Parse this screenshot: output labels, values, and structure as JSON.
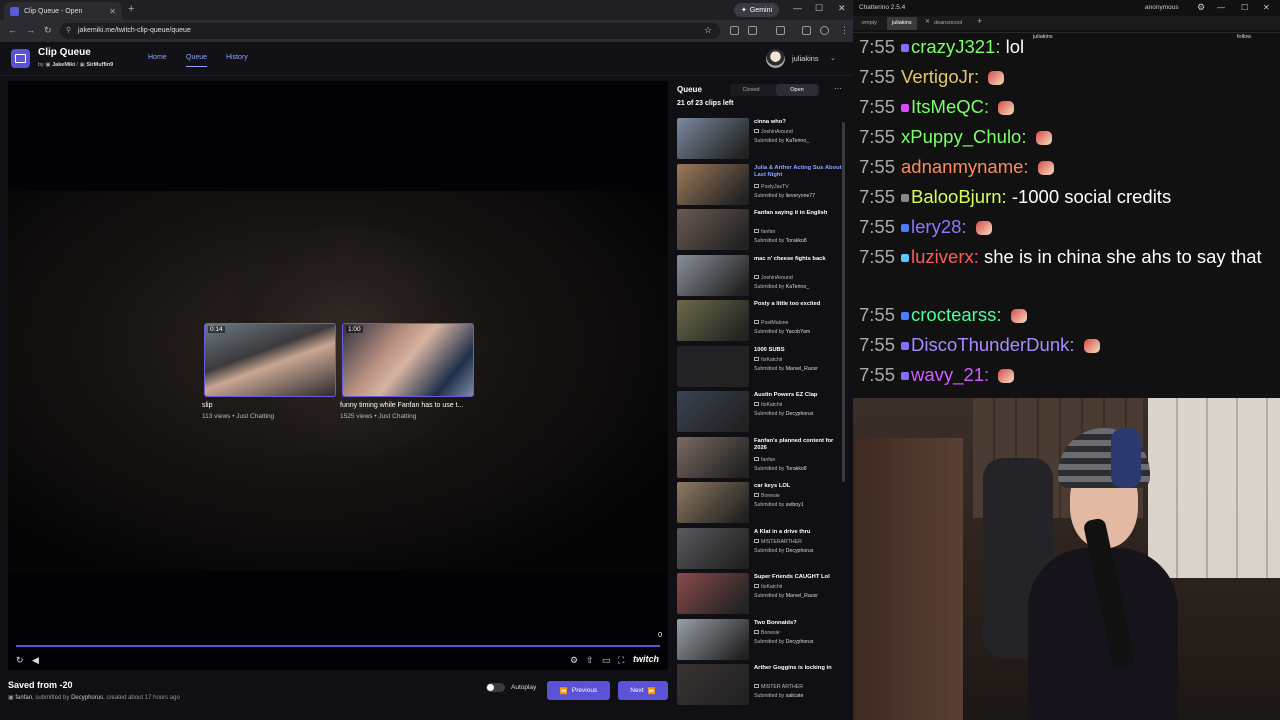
{
  "browser": {
    "tab_title": "Clip Queue - Open",
    "url": "jakemiki.me/twitch-clip-queue/queue",
    "gemini_label": "Gemini"
  },
  "app": {
    "title": "Clip Queue",
    "by_label": "by",
    "author1": "JakeMiki",
    "sep": "/",
    "author2": "SirMuffin9",
    "nav": [
      "Home",
      "Queue",
      "History"
    ],
    "user": "juliakins"
  },
  "player": {
    "clips": [
      {
        "duration": "0:14",
        "title": "slip",
        "meta": "113 views • Just Chatting"
      },
      {
        "duration": "1:00",
        "title": "funny timing while Fanfan has to use t...",
        "meta": "1525 views • Just Chatting"
      }
    ],
    "counter": "0",
    "twitch_logo": "twitch"
  },
  "current": {
    "title": "Saved from -20",
    "channel": "fanfan",
    "submitted_label": ", submitted by",
    "submitter": "Decyphorus",
    "created": ", created about 17 hours ago"
  },
  "controls": {
    "autoplay_label": "Autoplay",
    "previous_label": "Previous",
    "next_label": "Next"
  },
  "queue": {
    "heading": "Queue",
    "tab_closed": "Closed",
    "tab_open": "Open",
    "count_text": "21 of 23 clips left",
    "submitted_prefix": "Submitted by",
    "items": [
      {
        "title": "cinna who?",
        "channel": "JoshinAround",
        "submitter": "KaTerino_",
        "color": "#7a8aa0"
      },
      {
        "title": "Julia & Arther Acting Sus About Last Night",
        "channel": "PostyJasTV",
        "submitter": "lieveryone77",
        "color": "#9c7a5a"
      },
      {
        "title": "Fanfan saying it in English",
        "channel": "fanfan",
        "submitter": "Torakko8",
        "color": "#6a5a52"
      },
      {
        "title": "mac n' cheese fights back",
        "channel": "JoshinAround",
        "submitter": "KaTerino_",
        "color": "#8a8f9a"
      },
      {
        "title": "Posty a little too excited",
        "channel": "PostMalone",
        "submitter": "YacobYam",
        "color": "#6c6a4a"
      },
      {
        "title": "1000 SUBS",
        "channel": "ItsKatchii",
        "submitter": "Marvel_Racer",
        "color": "#222226"
      },
      {
        "title": "Austin Powers EZ Clap",
        "channel": "ItsKatchii",
        "submitter": "Decyphorus",
        "color": "#3a4252"
      },
      {
        "title": "Fanfan's planned content for 2026",
        "channel": "fanfan",
        "submitter": "Torakko8",
        "color": "#7b6a62"
      },
      {
        "title": "car keys LOL",
        "channel": "Bonesie",
        "submitter": "aviboy1",
        "color": "#8e7a62"
      },
      {
        "title": "A Klat in a drive thru",
        "channel": "MISTERARTHER",
        "submitter": "Decyphorus",
        "color": "#5a5a5e"
      },
      {
        "title": "Super Friends CAUGHT Lol",
        "channel": "ItsKatchii",
        "submitter": "Marvel_Racer",
        "color": "#8a4a4a"
      },
      {
        "title": "Two Bonnaids?",
        "channel": "Bonesie",
        "submitter": "Decyphorus",
        "color": "#9aa0a8"
      },
      {
        "title": "Arther Goggins is locking in",
        "channel": "MISTER ARTHER",
        "submitter": "salicate",
        "color": "#3a3433"
      }
    ]
  },
  "chatterino": {
    "title": "Chatterino 2.5.4",
    "account": "anonymous",
    "tabs": [
      "empty",
      "juliakins",
      "deansocool"
    ],
    "channel": "juliakins",
    "follow_label": "follow",
    "messages": [
      {
        "time": "7:55",
        "user": "crazyJ321:",
        "text": "lol",
        "color": "#7cff6b",
        "badge": "#8b6bff"
      },
      {
        "time": "7:55",
        "user": "VertigoJr:",
        "text": "",
        "color": "#e5c76b",
        "badge": ""
      },
      {
        "time": "7:55",
        "user": "ItsMeQC:",
        "text": "",
        "color": "#7cff6b",
        "badge": "#d64bff"
      },
      {
        "time": "7:55",
        "user": "xPuppy_Chulo:",
        "text": "",
        "color": "#7cff6b",
        "badge": ""
      },
      {
        "time": "7:55",
        "user": "adnanmyname:",
        "text": "",
        "color": "#ff8a5b",
        "badge": ""
      },
      {
        "time": "7:55",
        "user": "BalooBjurn:",
        "text": "-1000 social credits",
        "color": "#d6ff5b",
        "badge": "#888888"
      },
      {
        "time": "7:55",
        "user": "lery28:",
        "text": "",
        "color": "#8a7bff",
        "badge": "#4b7bff"
      },
      {
        "time": "7:55",
        "user": "luziverx:",
        "text": "she is in china she ahs to say that",
        "color": "#ff5b5b",
        "badge": "#5bc6ff"
      },
      {
        "time": "7:55",
        "user": "croctearss:",
        "text": "",
        "color": "#4bff9b",
        "badge": "#4b7bff"
      },
      {
        "time": "7:55",
        "user": "DiscoThunderDunk:",
        "text": "",
        "color": "#a98bff",
        "badge": "#8b6bff"
      },
      {
        "time": "7:55",
        "user": "wavy_21:",
        "text": "",
        "color": "#d65bff",
        "badge": "#8b6bff"
      }
    ]
  },
  "colors": {
    "accent": "#5b52d6",
    "link": "#8fa4ff",
    "background": "#0e0e10"
  }
}
